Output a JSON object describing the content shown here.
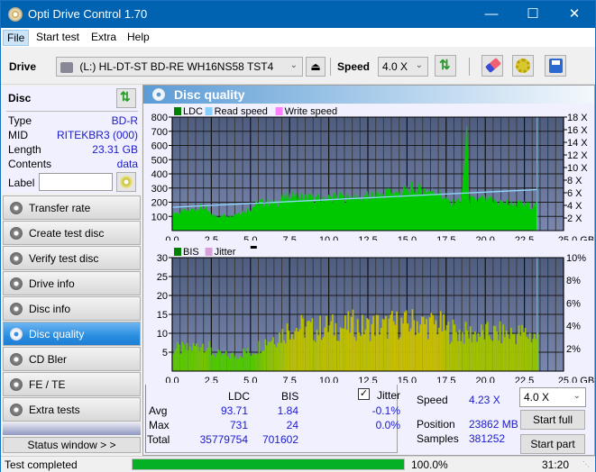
{
  "window": {
    "title": "Opti Drive Control 1.70",
    "controls": {
      "minimize": "—",
      "maximize": "☐",
      "close": "✕"
    }
  },
  "menu": [
    {
      "label": "File",
      "active": true
    },
    {
      "label": "Start test"
    },
    {
      "label": "Extra"
    },
    {
      "label": "Help"
    }
  ],
  "toolbar": {
    "drive_label": "Drive",
    "drive_value": "(L:)  HL-DT-ST BD-RE  WH16NS58 TST4",
    "speed_label": "Speed",
    "speed_value": "4.0 X",
    "icons": [
      "eject-icon",
      "refresh-icon",
      "eraser-icon",
      "settings-icon",
      "save-icon"
    ]
  },
  "disc": {
    "header": "Disc",
    "rows": [
      {
        "key": "Type",
        "value": "BD-R"
      },
      {
        "key": "MID",
        "value": "RITEKBR3 (000)"
      },
      {
        "key": "Length",
        "value": "23.31 GB"
      },
      {
        "key": "Contents",
        "value": "data"
      }
    ],
    "label_key": "Label",
    "label_value": ""
  },
  "nav": [
    {
      "label": "Transfer rate"
    },
    {
      "label": "Create test disc"
    },
    {
      "label": "Verify test disc"
    },
    {
      "label": "Drive info"
    },
    {
      "label": "Disc info"
    },
    {
      "label": "Disc quality",
      "selected": true
    },
    {
      "label": "CD Bler"
    },
    {
      "label": "FE / TE"
    },
    {
      "label": "Extra tests"
    }
  ],
  "status_window_label": "Status window > >",
  "panel_title": "Disc quality",
  "chart_data": [
    {
      "type": "area",
      "title": "LDC",
      "legend": [
        "LDC",
        "Read speed",
        "Write speed"
      ],
      "legend_colors": {
        "LDC": "#008000",
        "Read speed": "#87cefa",
        "Write speed": "#ff80ff"
      },
      "legend_position": "top-left",
      "x_ticks": [
        "0.0",
        "2.5",
        "5.0",
        "7.5",
        "10.0",
        "12.5",
        "15.0",
        "17.5",
        "20.0",
        "22.5",
        "25.0 GB"
      ],
      "xlim": [
        0,
        25
      ],
      "y_ticks_left": [
        "100",
        "200",
        "300",
        "400",
        "500",
        "600",
        "700",
        "800"
      ],
      "ylim_left": [
        0,
        800
      ],
      "y_ticks_right": [
        "2 X",
        "4 X",
        "6 X",
        "8 X",
        "10 X",
        "12 X",
        "14 X",
        "16 X",
        "18 X"
      ],
      "ylim_right": [
        0,
        18
      ],
      "grid": true,
      "data_end_gb": 23.31,
      "series": [
        {
          "name": "LDC",
          "x": [
            0,
            0.5,
            1,
            1.5,
            2,
            2.5,
            3,
            3.5,
            4,
            4.5,
            5,
            5.5,
            6,
            6.5,
            7,
            7.5,
            8,
            8.5,
            9,
            9.5,
            10,
            10.5,
            11,
            11.5,
            12,
            12.5,
            13,
            13.5,
            14,
            14.5,
            15,
            15.5,
            16,
            16.5,
            17,
            17.5,
            18,
            18.5,
            18.8,
            19,
            19.5,
            20,
            20.5,
            21,
            21.5,
            22,
            22.5,
            23,
            23.31
          ],
          "values": [
            130,
            140,
            150,
            170,
            180,
            120,
            110,
            120,
            130,
            150,
            170,
            210,
            220,
            200,
            240,
            270,
            260,
            250,
            250,
            240,
            250,
            260,
            250,
            260,
            250,
            260,
            270,
            280,
            300,
            280,
            310,
            320,
            310,
            300,
            300,
            230,
            220,
            240,
            731,
            230,
            230,
            240,
            220,
            220,
            210,
            200,
            200,
            190,
            190
          ]
        },
        {
          "name": "Read speed",
          "x": [
            0,
            2.5,
            5,
            7.5,
            10,
            12.5,
            15,
            17.5,
            20,
            22.5,
            23.31
          ],
          "values": [
            3.7,
            4.0,
            4.3,
            4.6,
            4.9,
            5.2,
            5.5,
            5.8,
            6.1,
            6.4,
            6.5
          ]
        }
      ]
    },
    {
      "type": "bar",
      "title": "BIS",
      "legend": [
        "BIS",
        "Jitter"
      ],
      "legend_colors": {
        "BIS": "#008000",
        "Jitter": "#d8a0d8"
      },
      "legend_position": "top-left",
      "x_ticks": [
        "0.0",
        "2.5",
        "5.0",
        "7.5",
        "10.0",
        "12.5",
        "15.0",
        "17.5",
        "20.0",
        "22.5",
        "25.0 GB"
      ],
      "xlim": [
        0,
        25
      ],
      "y_ticks_left": [
        "5",
        "10",
        "15",
        "20",
        "25",
        "30"
      ],
      "ylim_left": [
        0,
        30
      ],
      "y_ticks_right": [
        "2%",
        "4%",
        "6%",
        "8%",
        "10%"
      ],
      "ylim_right": [
        0,
        10
      ],
      "grid": true,
      "data_end_gb": 23.31,
      "series": [
        {
          "name": "BIS",
          "x": [
            0,
            0.5,
            1,
            1.5,
            2,
            2.5,
            3,
            3.5,
            4,
            4.5,
            5,
            5.5,
            6,
            6.5,
            7,
            7.5,
            8,
            8.5,
            9,
            9.5,
            10,
            10.5,
            11,
            11.5,
            12,
            12.5,
            13,
            13.5,
            14,
            14.5,
            15,
            15.5,
            16,
            16.5,
            17,
            17.5,
            18,
            18.5,
            19,
            19.5,
            20,
            20.5,
            21,
            21.5,
            22,
            22.5,
            23,
            23.31
          ],
          "values": [
            7,
            7,
            7,
            8,
            9,
            6,
            5,
            5,
            5,
            6,
            6,
            8,
            10,
            11,
            12,
            14,
            14,
            14,
            13,
            14,
            14,
            14,
            14,
            15,
            14,
            14,
            15,
            14,
            15,
            15,
            15,
            16,
            15,
            15,
            15,
            13,
            13,
            12,
            12,
            12,
            12,
            12,
            12,
            12,
            12,
            12,
            11,
            11
          ]
        }
      ]
    }
  ],
  "stats": {
    "col_ldc": "LDC",
    "col_bis": "BIS",
    "rows": [
      {
        "label": "Avg",
        "ldc": "93.71",
        "bis": "1.84",
        "jitter": "-0.1%"
      },
      {
        "label": "Max",
        "ldc": "731",
        "bis": "24",
        "jitter": "0.0%"
      },
      {
        "label": "Total",
        "ldc": "35779754",
        "bis": "701602"
      }
    ],
    "jitter_label": "Jitter",
    "jitter_checked": true,
    "speed_label": "Speed",
    "speed_value": "4.23 X",
    "position_label": "Position",
    "position_value": "23862 MB",
    "samples_label": "Samples",
    "samples_value": "381252",
    "speed_select": "4.0 X",
    "start_full": "Start full",
    "start_part": "Start part"
  },
  "statusbar": {
    "status": "Test completed",
    "progress_percent": 100.0,
    "progress_label": "100.0%",
    "time": "31:20"
  }
}
